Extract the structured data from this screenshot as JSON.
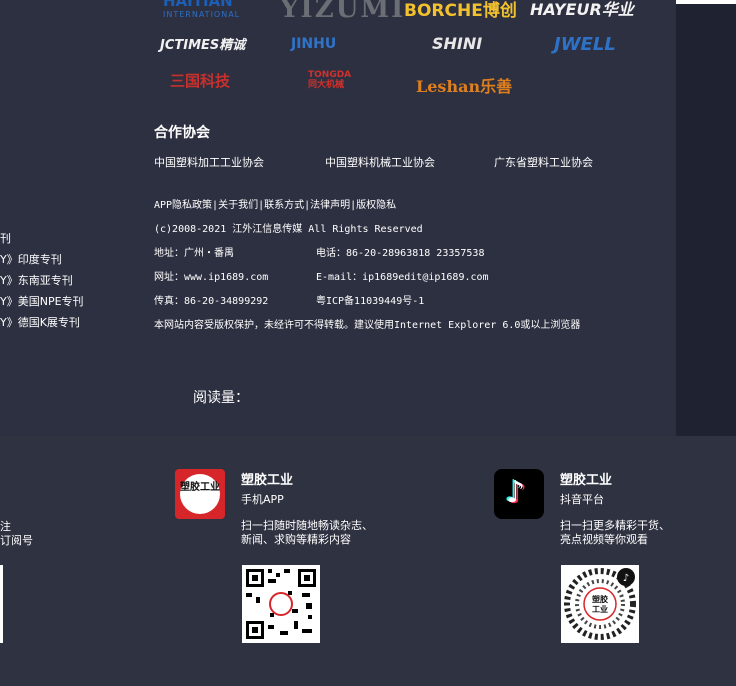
{
  "logos": {
    "haitian": {
      "name": "HAITIAN",
      "sub": "INTERNATIONAL"
    },
    "yizumi": "YIZUMI",
    "borche": "BORCHE博创",
    "hayeur": "HAYEUR华业",
    "jctimes": "JCTIMES精诚",
    "jinhu": "JINHU",
    "shini": "SHINI",
    "jwell": "JWELL",
    "sanxie": "三国科技",
    "tongda": {
      "en": "TONGDA",
      "cn": "同大机械"
    },
    "leshan": "Leshan乐善"
  },
  "associations": {
    "title": "合作协会",
    "items": [
      "中国塑料加工工业协会",
      "中国塑料机械工业协会",
      "广东省塑料工业协会"
    ]
  },
  "info": {
    "links": "APP隐私政策|关于我们|联系方式|法律声明|版权隐私",
    "copyright": "(c)2008-2021 江外江信息传媒 All Rights Reserved",
    "address": "地址：广州・番禺",
    "phone": "电话：86-20-28963818 23357538",
    "website": "网址：www.ip1689.com",
    "email": "E-mail：ip1689edit@ip1689.com",
    "fax": "传真：86-20-34899292",
    "icp": "粤ICP备11039449号-1",
    "notice": "本网站内容受版权保护，未经许可不得转载。建议使用Internet Explorer 6.0或以上浏览器"
  },
  "left_list": [
    "刊",
    "Y》印度专刊",
    "Y》东南亚专刊",
    "Y》美国NPE专刊",
    "Y》德国K展专刊"
  ],
  "readcount": "阅读量：",
  "apps": [
    {
      "icon_text": "塑胶工业",
      "title": "塑胶工业",
      "sub": "手机APP",
      "desc1": "扫一扫随时随地畅读杂志、",
      "desc2": "新闻、求购等精彩内容"
    },
    {
      "icon": "tiktok-icon",
      "title": "塑胶工业",
      "sub": "抖音平台",
      "desc1": "扫一扫更多精彩干货、",
      "desc2": "亮点视频等你观看"
    }
  ],
  "left_partial": [
    "注",
    "订阅号"
  ]
}
